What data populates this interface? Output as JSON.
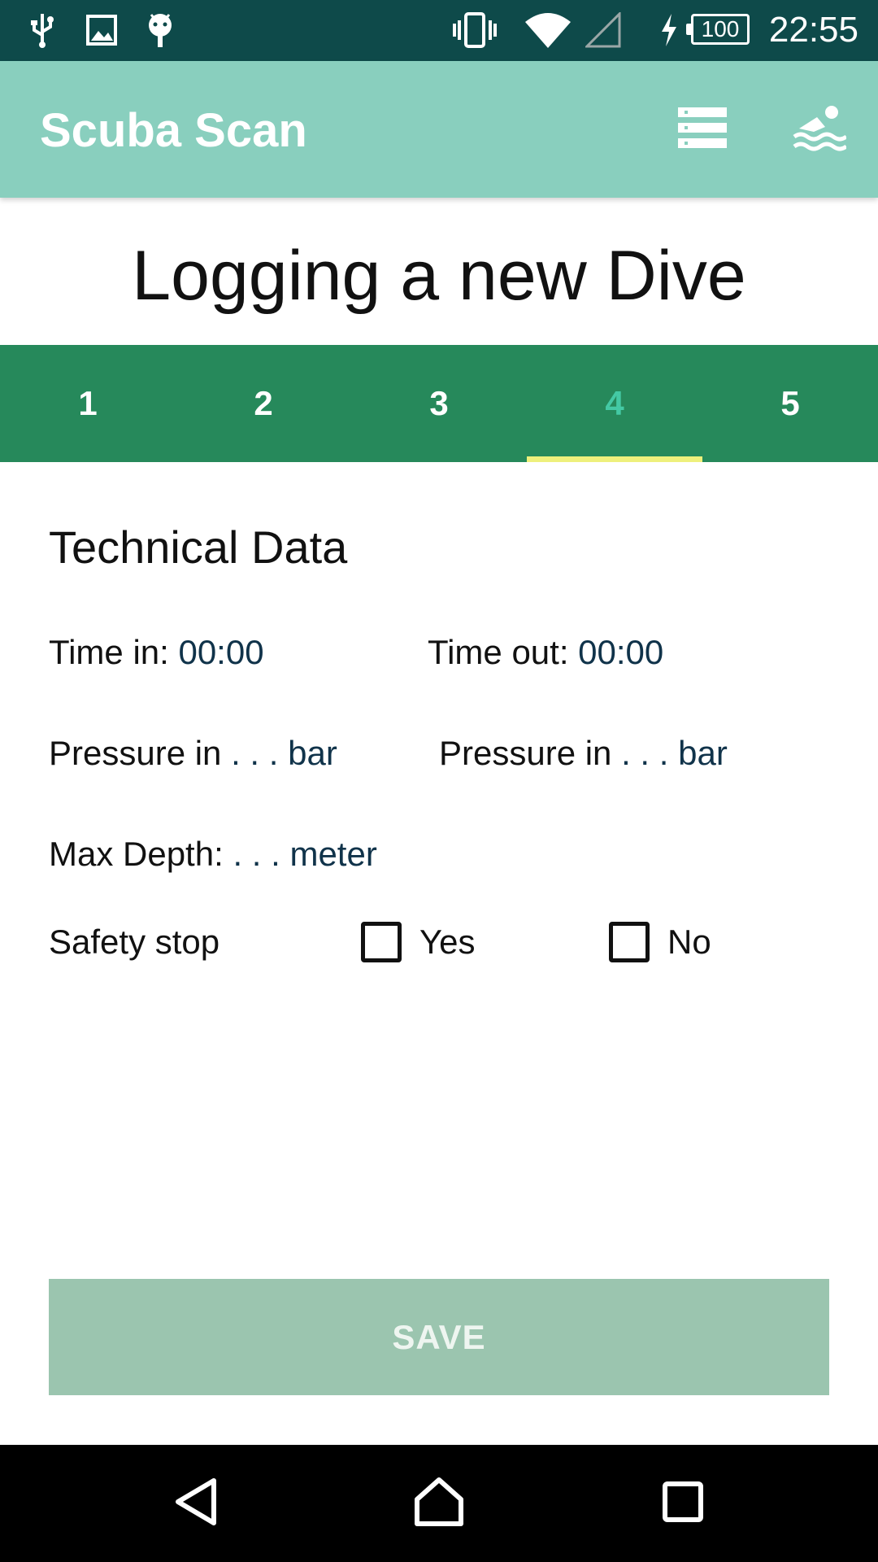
{
  "status_bar": {
    "time": "22:55",
    "battery": "100",
    "icons": [
      "usb-icon",
      "image-icon",
      "android-icon",
      "vibrate-icon",
      "wifi-icon",
      "cellular-signal-icon",
      "charging-icon",
      "battery-icon"
    ]
  },
  "app_bar": {
    "title": "Scuba Scan",
    "actions": [
      "list-icon",
      "swimmer-icon"
    ]
  },
  "page": {
    "title": "Logging a new Dive"
  },
  "tabs": [
    {
      "label": "1",
      "active": false
    },
    {
      "label": "2",
      "active": false
    },
    {
      "label": "3",
      "active": false
    },
    {
      "label": "4",
      "active": true
    },
    {
      "label": "5",
      "active": false
    }
  ],
  "form": {
    "section_title": "Technical Data",
    "time_in_label": "Time in: ",
    "time_in_value": "00:00",
    "time_out_label": "Time out: ",
    "time_out_value": "00:00",
    "pressure_in_1_label": "Pressure in ",
    "pressure_in_1_value": ". . . bar",
    "pressure_in_2_label": "Pressure in ",
    "pressure_in_2_value": ". . . bar",
    "max_depth_label": "Max Depth: ",
    "max_depth_value": ". . . meter",
    "safety_stop_label": "Safety stop",
    "yes_label": "Yes",
    "no_label": "No",
    "yes_checked": false,
    "no_checked": false
  },
  "save_button": "SAVE",
  "colors": {
    "status_bar": "#0e4a4a",
    "app_bar": "#89cfbe",
    "tab_bar": "#26895b",
    "tab_active_text": "#44c9a4",
    "tab_indicator": "#eef07c",
    "save_button": "#9bc5af",
    "value_text": "#10334a"
  }
}
